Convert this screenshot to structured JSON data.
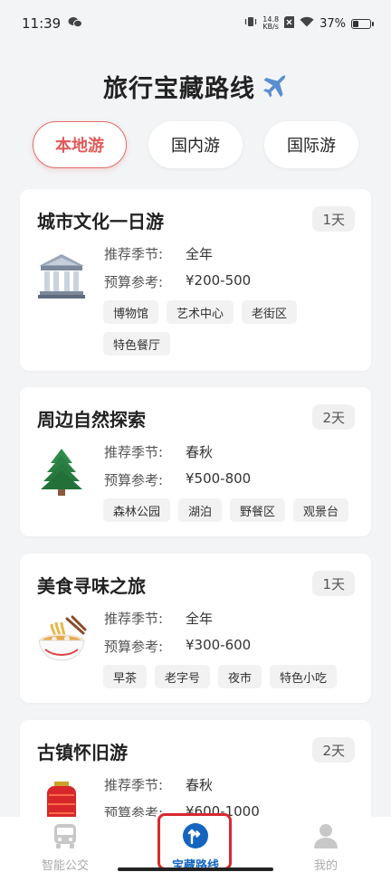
{
  "status": {
    "time": "11:39",
    "net_speed_value": "14.8",
    "net_speed_unit": "KB/s",
    "battery": "37%"
  },
  "header": {
    "title": "旅行宝藏路线"
  },
  "tabs": [
    {
      "label": "本地游",
      "active": true
    },
    {
      "label": "国内游",
      "active": false
    },
    {
      "label": "国际游",
      "active": false
    }
  ],
  "labels": {
    "season": "推荐季节:",
    "budget": "预算参考:"
  },
  "routes": [
    {
      "title": "城市文化一日游",
      "days": "1天",
      "season": "全年",
      "budget": "¥200-500",
      "icon": "museum-icon",
      "tags": [
        "博物馆",
        "艺术中心",
        "老街区",
        "特色餐厅"
      ]
    },
    {
      "title": "周边自然探索",
      "days": "2天",
      "season": "春秋",
      "budget": "¥500-800",
      "icon": "tree-icon",
      "tags": [
        "森林公园",
        "湖泊",
        "野餐区",
        "观景台"
      ]
    },
    {
      "title": "美食寻味之旅",
      "days": "1天",
      "season": "全年",
      "budget": "¥300-600",
      "icon": "noodles-icon",
      "tags": [
        "早茶",
        "老字号",
        "夜市",
        "特色小吃"
      ]
    },
    {
      "title": "古镇怀旧游",
      "days": "2天",
      "season": "春秋",
      "budget": "¥600-1000",
      "icon": "lantern-icon",
      "tags": []
    }
  ],
  "bottom_nav": [
    {
      "label": "智能公交",
      "icon": "bus-icon",
      "active": false
    },
    {
      "label": "宝藏路线",
      "icon": "route-icon",
      "active": true
    },
    {
      "label": "我的",
      "icon": "user-icon",
      "active": false
    }
  ],
  "colors": {
    "accent_red": "#e25a5a",
    "nav_active_blue": "#1565c0",
    "highlight_red": "#d9282f"
  }
}
